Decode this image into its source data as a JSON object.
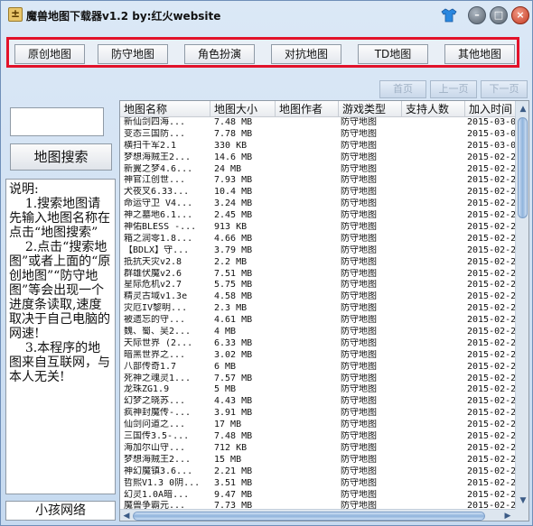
{
  "window": {
    "title": "魔兽地图下载器v1.2  by:红火website",
    "app_icon": "±",
    "minimize_glyph": "–",
    "maximize_glyph": "□",
    "close_glyph": "×"
  },
  "categories": [
    "原创地图",
    "防守地图",
    "角色扮演",
    "对抗地图",
    "TD地图",
    "其他地图"
  ],
  "search": {
    "value": "",
    "button_label": "地图搜索"
  },
  "description": "说明:\n    1.搜索地图请先输入地图名称在点击“地图搜索”\n    2.点击“搜索地图”或者上面的“原创地图”“防守地图”等会出现一个进度条读取,速度取决于自己电脑的网速!\n    3.本程序的地图来自互联网，与本人无关!",
  "footer": "小孩网络",
  "pager": {
    "first": "首页",
    "prev": "上一页",
    "next": "下一页"
  },
  "table": {
    "headers": [
      "地图名称",
      "地图大小",
      "地图作者",
      "游戏类型",
      "支持人数",
      "加入时间"
    ],
    "rows": [
      [
        "新仙剑四海...",
        "7.48 MB",
        "",
        "防守地图",
        "",
        "2015-03-0"
      ],
      [
        "变态三国防...",
        "7.78 MB",
        "",
        "防守地图",
        "",
        "2015-03-0"
      ],
      [
        "横扫千军2.1",
        "330 KB",
        "",
        "防守地图",
        "",
        "2015-03-0"
      ],
      [
        "梦想海贼王2...",
        "14.6 MB",
        "",
        "防守地图",
        "",
        "2015-02-2"
      ],
      [
        "新翼之梦4.6...",
        "24 MB",
        "",
        "防守地图",
        "",
        "2015-02-2"
      ],
      [
        "神官江创世...",
        "7.93 MB",
        "",
        "防守地图",
        "",
        "2015-02-2"
      ],
      [
        "犬夜叉6.33...",
        "10.4 MB",
        "",
        "防守地图",
        "",
        "2015-02-2"
      ],
      [
        "命运守卫 V4...",
        "3.24 MB",
        "",
        "防守地图",
        "",
        "2015-02-2"
      ],
      [
        "神之墓地6.1...",
        "2.45 MB",
        "",
        "防守地图",
        "",
        "2015-02-2"
      ],
      [
        "神佑BLESS -...",
        "913 KB",
        "",
        "防守地图",
        "",
        "2015-02-2"
      ],
      [
        "箱之润零1.8...",
        "4.66 MB",
        "",
        "防守地图",
        "",
        "2015-02-2"
      ],
      [
        "【BDLX】守...",
        "3.79 MB",
        "",
        "防守地图",
        "",
        "2015-02-2"
      ],
      [
        "抵抗天灾v2.8",
        "2.2 MB",
        "",
        "防守地图",
        "",
        "2015-02-2"
      ],
      [
        "群雄伏魔v2.6",
        "7.51 MB",
        "",
        "防守地图",
        "",
        "2015-02-2"
      ],
      [
        "星际危机v2.7",
        "5.75 MB",
        "",
        "防守地图",
        "",
        "2015-02-2"
      ],
      [
        "精灵古域v1.3e",
        "4.58 MB",
        "",
        "防守地图",
        "",
        "2015-02-2"
      ],
      [
        "灾厄IV黎明...",
        "2.3 MB",
        "",
        "防守地图",
        "",
        "2015-02-2"
      ],
      [
        "被遗忘的守...",
        "4.61 MB",
        "",
        "防守地图",
        "",
        "2015-02-2"
      ],
      [
        "魏、蜀、吴2...",
        "4 MB",
        "",
        "防守地图",
        "",
        "2015-02-2"
      ],
      [
        "天际世界 (2...",
        "6.33 MB",
        "",
        "防守地图",
        "",
        "2015-02-2"
      ],
      [
        "暗黑世界之...",
        "3.02 MB",
        "",
        "防守地图",
        "",
        "2015-02-2"
      ],
      [
        "八部传奇1.7",
        "6 MB",
        "",
        "防守地图",
        "",
        "2015-02-2"
      ],
      [
        "死神之魂灵1...",
        "7.57 MB",
        "",
        "防守地图",
        "",
        "2015-02-2"
      ],
      [
        "龙珠ZG1.9",
        "5 MB",
        "",
        "防守地图",
        "",
        "2015-02-2"
      ],
      [
        "幻梦之晓苏...",
        "4.43 MB",
        "",
        "防守地图",
        "",
        "2015-02-2"
      ],
      [
        "疯神封魔传-...",
        "3.91 MB",
        "",
        "防守地图",
        "",
        "2015-02-2"
      ],
      [
        "仙剑问道之...",
        "17 MB",
        "",
        "防守地图",
        "",
        "2015-02-2"
      ],
      [
        "三国传3.5-...",
        "7.48 MB",
        "",
        "防守地图",
        "",
        "2015-02-2"
      ],
      [
        "海加尔山守...",
        "712 KB",
        "",
        "防守地图",
        "",
        "2015-02-2"
      ],
      [
        "梦想海贼王2...",
        "15 MB",
        "",
        "防守地图",
        "",
        "2015-02-2"
      ],
      [
        "神幻魔镇3.6...",
        "2.21 MB",
        "",
        "防守地图",
        "",
        "2015-02-2"
      ],
      [
        "哲熙V1.3 0阴...",
        "3.51 MB",
        "",
        "防守地图",
        "",
        "2015-02-2"
      ],
      [
        "幻灵1.0A暗...",
        "9.47 MB",
        "",
        "防守地图",
        "",
        "2015-02-2"
      ],
      [
        "魔兽争霸元...",
        "7.73 MB",
        "",
        "防守地图",
        "",
        "2015-02-2"
      ]
    ]
  },
  "colors": {
    "accent_border": "#e2122a",
    "window_bg": "#c6daf0"
  }
}
